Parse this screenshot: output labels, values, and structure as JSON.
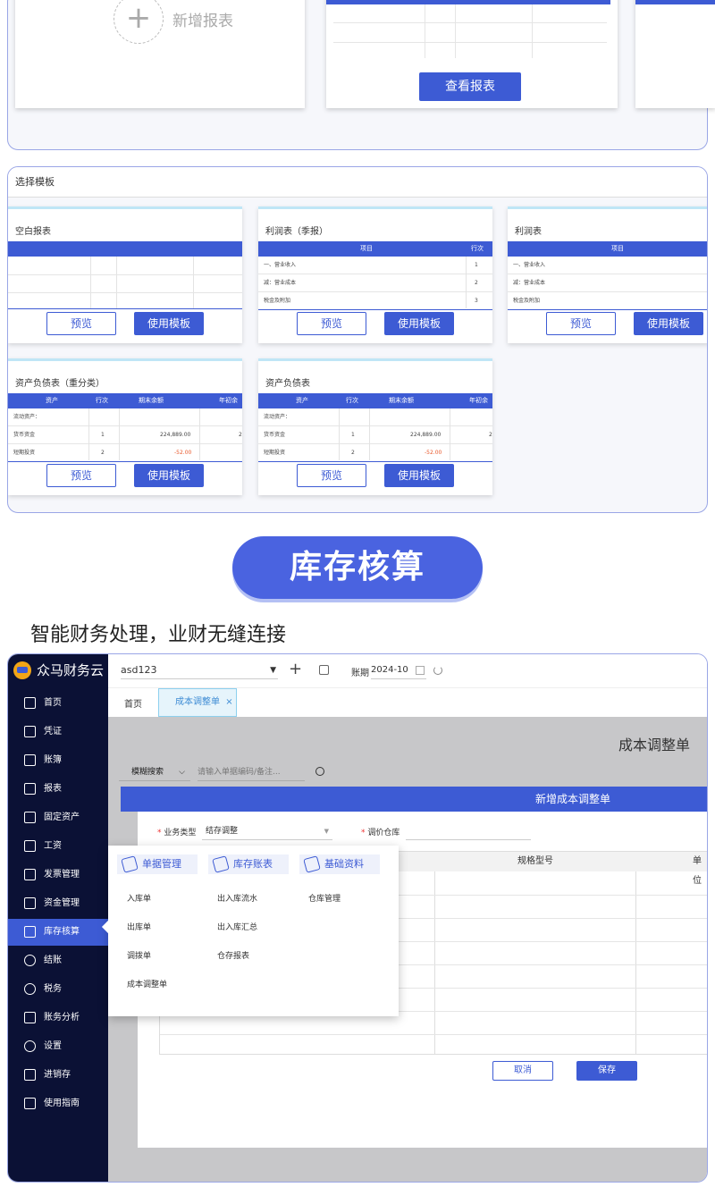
{
  "top_section": {
    "add_report_label": "新增报表",
    "view_report_button": "查看报表"
  },
  "templates": {
    "header": "选择模板",
    "preview_label": "预览",
    "use_label": "使用模板",
    "cards": [
      {
        "title": "空白报表"
      },
      {
        "title": "利润表（季报）",
        "col1": "项目",
        "col2": "行次",
        "rows": [
          [
            "一、营业收入",
            "1"
          ],
          [
            "减：营业成本",
            "2"
          ],
          [
            "税金及附加",
            "3"
          ]
        ]
      },
      {
        "title": "利润表",
        "col1": "项目",
        "rows": [
          [
            "一、营业收入"
          ],
          [
            "减：营业成本"
          ],
          [
            "税金及附加"
          ]
        ]
      },
      {
        "title": "资产负债表（重分类）",
        "cols": [
          "资产",
          "行次",
          "期末余额",
          "年初余"
        ],
        "rows": [
          [
            "流动资产：",
            "",
            "",
            ""
          ],
          [
            "货币资金",
            "1",
            "224,889.00",
            "2"
          ],
          [
            "短期投资",
            "2",
            "-52.00",
            ""
          ]
        ]
      },
      {
        "title": "资产负债表",
        "cols": [
          "资产",
          "行次",
          "期末余额",
          "年初余"
        ],
        "rows": [
          [
            "流动资产：",
            "",
            "",
            ""
          ],
          [
            "货币资金",
            "1",
            "224,889.00",
            "2"
          ],
          [
            "短期投资",
            "2",
            "-52.00",
            ""
          ]
        ]
      }
    ]
  },
  "section_heading": "库存核算",
  "section_subtitle": "智能财务处理，业财无缝连接",
  "app": {
    "brand": "众马财务云",
    "account_select": "asd123",
    "period_label": "账期",
    "period_value": "2024-10",
    "nav": [
      {
        "label": "首页",
        "icon": "home-icon"
      },
      {
        "label": "凭证",
        "icon": "voucher-icon"
      },
      {
        "label": "账簿",
        "icon": "ledger-icon"
      },
      {
        "label": "报表",
        "icon": "report-icon"
      },
      {
        "label": "固定资产",
        "icon": "asset-icon"
      },
      {
        "label": "工资",
        "icon": "salary-icon"
      },
      {
        "label": "发票管理",
        "icon": "invoice-icon"
      },
      {
        "label": "资金管理",
        "icon": "fund-icon"
      },
      {
        "label": "库存核算",
        "icon": "inventory-icon"
      },
      {
        "label": "结账",
        "icon": "closing-icon"
      },
      {
        "label": "税务",
        "icon": "tax-icon"
      },
      {
        "label": "账务分析",
        "icon": "analysis-icon"
      },
      {
        "label": "设置",
        "icon": "gear-icon"
      },
      {
        "label": "进销存",
        "icon": "stock-icon"
      },
      {
        "label": "使用指南",
        "icon": "guide-icon"
      }
    ],
    "tabs": {
      "home": "首页",
      "active": "成本调整单",
      "close": "×"
    },
    "page_title": "成本调整单",
    "search_mode": "模糊搜索",
    "search_placeholder": "请输入单据编码/备注...",
    "dialog": {
      "title": "新增成本调整单",
      "business_type_label": "业务类型",
      "business_type_value": "结存调整",
      "warehouse_label": "调价仓库",
      "col_spec": "规格型号",
      "col_unit": "单位",
      "cancel": "取消",
      "save": "保存"
    },
    "flyout": {
      "groups": [
        {
          "title": "单据管理",
          "items": [
            "入库单",
            "出库单",
            "调拨单",
            "成本调整单"
          ]
        },
        {
          "title": "库存账表",
          "items": [
            "出入库流水",
            "出入库汇总",
            "仓存报表"
          ]
        },
        {
          "title": "基础资料",
          "items": [
            "仓库管理"
          ]
        }
      ]
    }
  }
}
